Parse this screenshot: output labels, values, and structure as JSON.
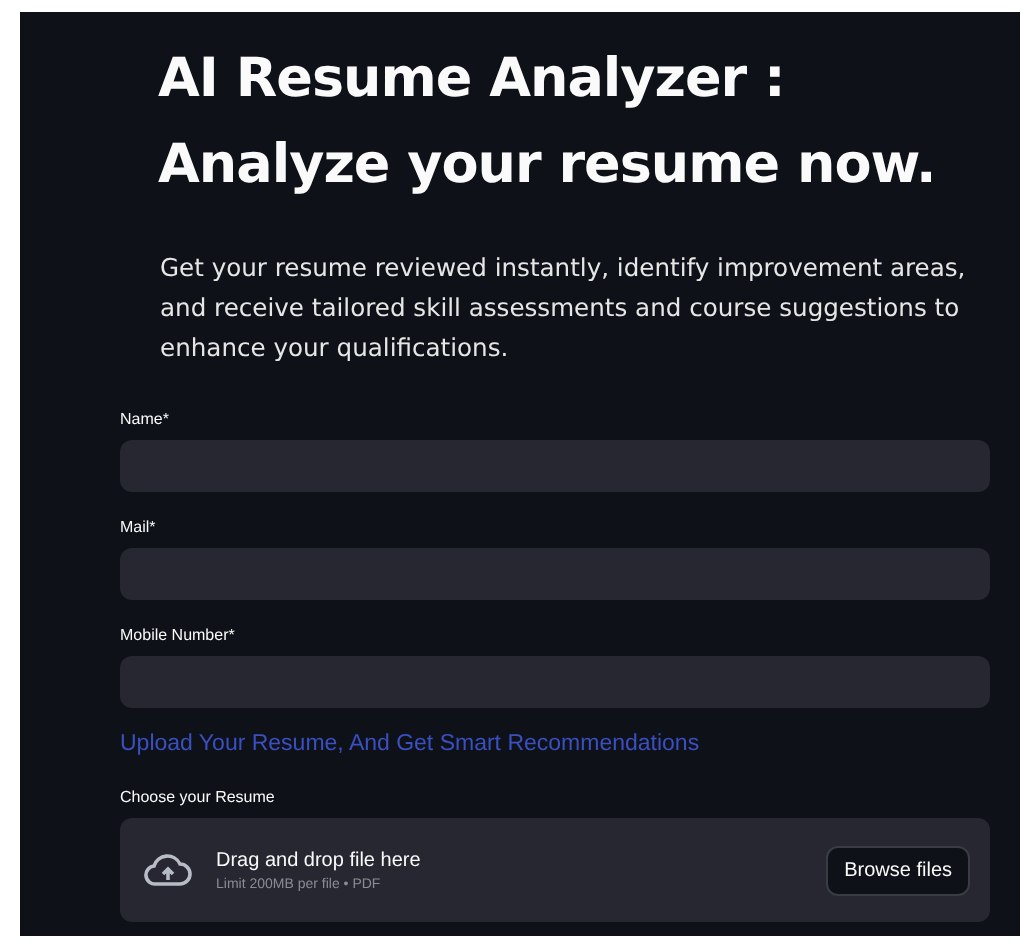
{
  "title_lines": [
    "AI Resume Analyzer :",
    "Analyze your resume  now."
  ],
  "description": "Get your resume reviewed instantly, identify improvement areas, and receive tailored skill assessments and course suggestions to enhance your qualifications.",
  "fields": [
    {
      "label": "Name*"
    },
    {
      "label": "Mail*"
    },
    {
      "label": "Mobile Number*"
    }
  ],
  "upload_heading": "Upload Your Resume, And Get Smart Recommendations",
  "uploader": {
    "label": "Choose your Resume",
    "instruction": "Drag and drop file here",
    "limit": "Limit 200MB per file • PDF",
    "button": "Browse files"
  }
}
